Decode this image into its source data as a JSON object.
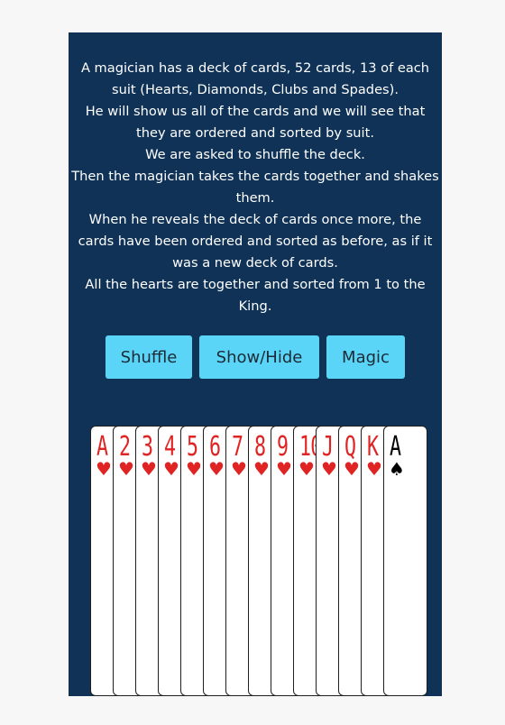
{
  "intro": {
    "lines": [
      "A magician has a deck of cards, 52 cards, 13 of each suit (Hearts, Diamonds, Clubs and Spades).",
      "He will show us all of the cards and we will see that they are ordered and sorted by suit.",
      "We are asked to shuffle the deck.",
      "Then the magician takes the cards together and shakes them.",
      "When he reveals the deck of cards once more, the cards have been ordered and sorted as before, as if it was a new deck of cards.",
      "All the hearts are together and sorted from 1 to the King."
    ]
  },
  "buttons": {
    "shuffle": "Shuffle",
    "show_hide": "Show/Hide",
    "magic": "Magic"
  },
  "colors": {
    "panel": "#0f3256",
    "button": "#5ad5f8",
    "red_suit": "#e02424",
    "black_suit": "#000000"
  },
  "cards": [
    {
      "rank": "A",
      "suit": "♥",
      "suit_name": "hearts",
      "color": "red"
    },
    {
      "rank": "2",
      "suit": "♥",
      "suit_name": "hearts",
      "color": "red"
    },
    {
      "rank": "3",
      "suit": "♥",
      "suit_name": "hearts",
      "color": "red"
    },
    {
      "rank": "4",
      "suit": "♥",
      "suit_name": "hearts",
      "color": "red"
    },
    {
      "rank": "5",
      "suit": "♥",
      "suit_name": "hearts",
      "color": "red"
    },
    {
      "rank": "6",
      "suit": "♥",
      "suit_name": "hearts",
      "color": "red"
    },
    {
      "rank": "7",
      "suit": "♥",
      "suit_name": "hearts",
      "color": "red"
    },
    {
      "rank": "8",
      "suit": "♥",
      "suit_name": "hearts",
      "color": "red"
    },
    {
      "rank": "9",
      "suit": "♥",
      "suit_name": "hearts",
      "color": "red"
    },
    {
      "rank": "10",
      "suit": "♥",
      "suit_name": "hearts",
      "color": "red"
    },
    {
      "rank": "J",
      "suit": "♥",
      "suit_name": "hearts",
      "color": "red"
    },
    {
      "rank": "Q",
      "suit": "♥",
      "suit_name": "hearts",
      "color": "red"
    },
    {
      "rank": "K",
      "suit": "♥",
      "suit_name": "hearts",
      "color": "red"
    },
    {
      "rank": "A",
      "suit": "♠",
      "suit_name": "spades",
      "color": "black"
    }
  ]
}
